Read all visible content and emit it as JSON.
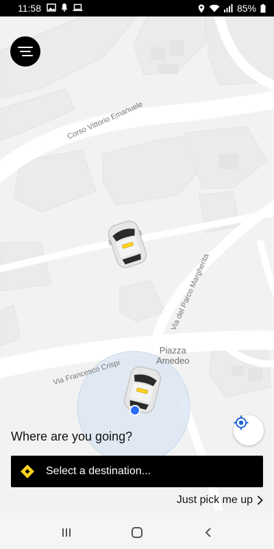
{
  "status_bar": {
    "time": "11:58",
    "battery": "85%"
  },
  "map": {
    "streets": {
      "corso": "Corso Vittorio Emanuele",
      "parco": "Via del Parco Margherita",
      "crispi": "Via Francesco Crispi"
    },
    "poi": {
      "line1": "Piazza",
      "line2": "Amedeo"
    }
  },
  "prompt": "Where are you going?",
  "destination_label": "Select a destination...",
  "pickup_label": "Just pick me up",
  "colors": {
    "accent": "#ffd21f",
    "location_dot": "#2d6df6",
    "radius_fill": "#dde8f3"
  },
  "icons": [
    "menu-icon",
    "my-location-icon",
    "diamond-icon",
    "chevron-right-icon",
    "recents-icon",
    "home-icon",
    "back-icon",
    "car-icon"
  ]
}
